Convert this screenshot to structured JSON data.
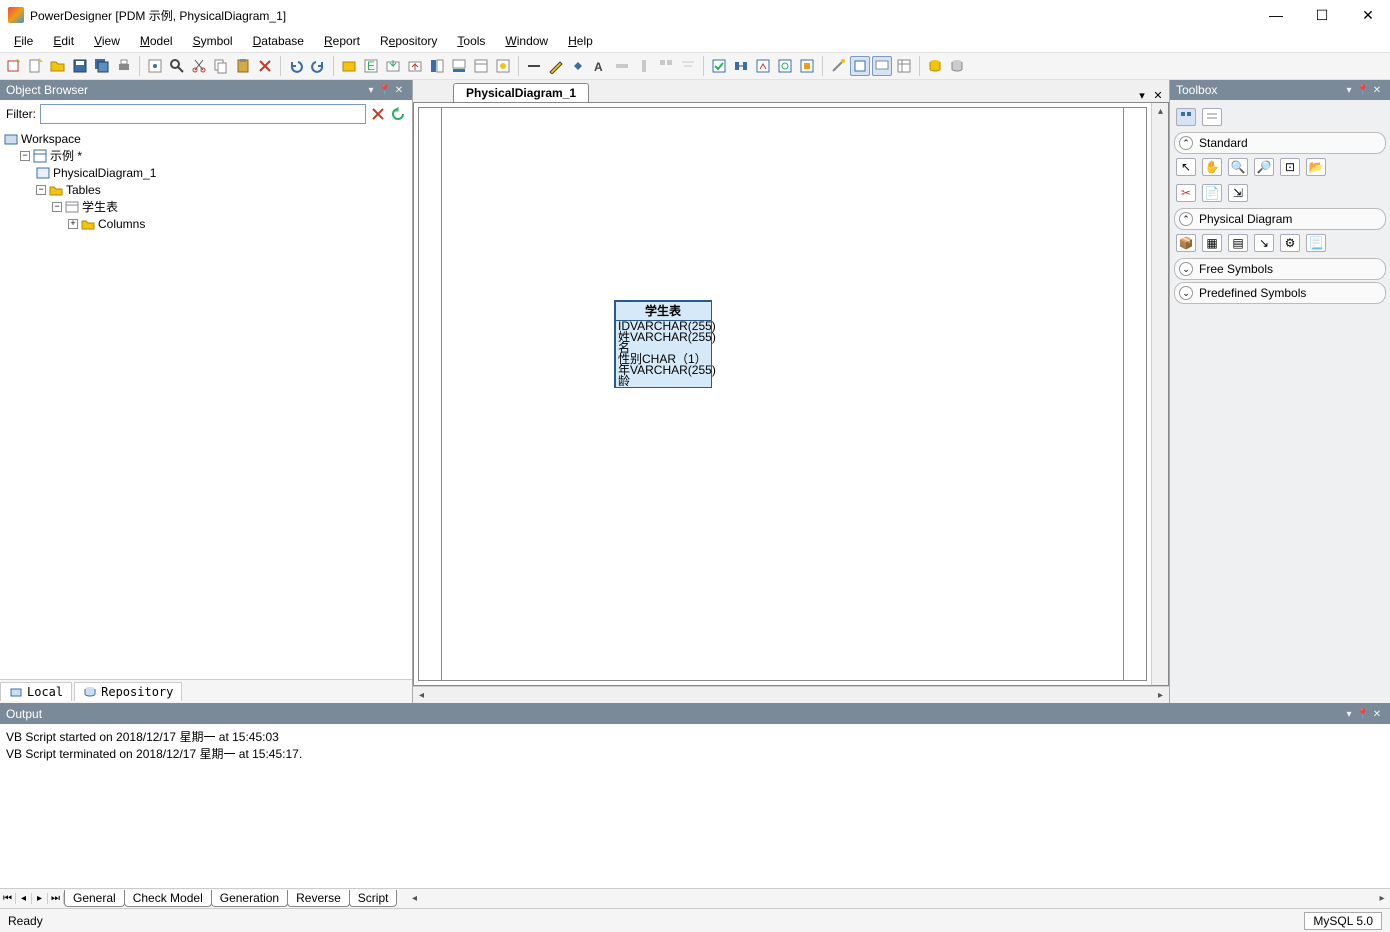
{
  "title": "PowerDesigner [PDM 示例, PhysicalDiagram_1]",
  "menu": [
    "File",
    "Edit",
    "View",
    "Model",
    "Symbol",
    "Database",
    "Report",
    "Repository",
    "Tools",
    "Window",
    "Help"
  ],
  "panels": {
    "browser": "Object Browser",
    "toolbox": "Toolbox",
    "output": "Output"
  },
  "filter_label": "Filter:",
  "tree": {
    "workspace": "Workspace",
    "model": "示例 *",
    "diagram": "PhysicalDiagram_1",
    "tables": "Tables",
    "table1": "学生表",
    "columns": "Columns"
  },
  "browser_tabs": {
    "local": "Local",
    "repository": "Repository"
  },
  "diagram_tab": "PhysicalDiagram_1",
  "entity": {
    "name": "学生表",
    "cols": [
      {
        "n": "ID",
        "t": "VARCHAR(255)"
      },
      {
        "n": "姓名",
        "t": "VARCHAR(255)"
      },
      {
        "n": "性别",
        "t": "CHAR（1）"
      },
      {
        "n": "年龄",
        "t": "VARCHAR(255)"
      }
    ]
  },
  "toolbox": {
    "sections": [
      "Standard",
      "Physical Diagram",
      "Free Symbols",
      "Predefined Symbols"
    ]
  },
  "output_lines": [
    "VB Script started on 2018/12/17 星期一 at 15:45:03",
    "VB Script terminated on 2018/12/17 星期一 at 15:45:17."
  ],
  "output_tabs": [
    "General",
    "Check Model",
    "Generation",
    "Reverse",
    "Script"
  ],
  "status": {
    "left": "Ready",
    "right": "MySQL 5.0"
  }
}
